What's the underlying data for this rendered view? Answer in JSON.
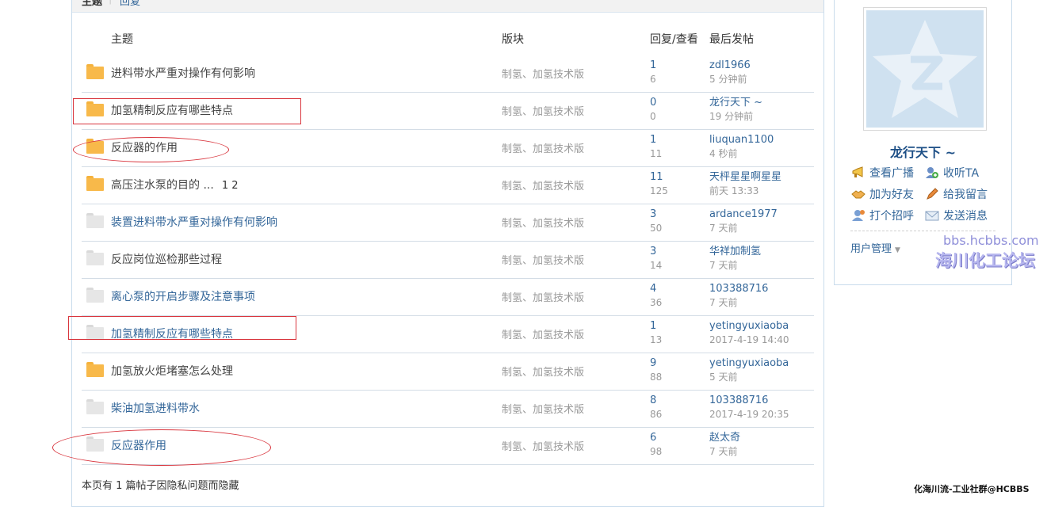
{
  "tabs": {
    "topic": "主题",
    "separator": "|",
    "reply": "回复"
  },
  "columns": {
    "topic": "主题",
    "forum": "版块",
    "stats": "回复/查看",
    "last_post": "最后发帖"
  },
  "threads": [
    {
      "icon": "folder-open",
      "title": "进料带水严重对操作有何影响",
      "forum": "制氢、加氢技术版",
      "replies": "1",
      "views": "6",
      "last_user": "zdl1966",
      "last_time": "5 分钟前"
    },
    {
      "icon": "folder-open",
      "title": "加氢精制反应有哪些特点",
      "forum": "制氢、加氢技术版",
      "replies": "0",
      "views": "0",
      "last_user": "龙行天下 ~",
      "last_time": "19 分钟前"
    },
    {
      "icon": "folder-open",
      "title": "反应器的作用",
      "forum": "制氢、加氢技术版",
      "replies": "1",
      "views": "11",
      "last_user": "liuquan1100",
      "last_time": "4 秒前"
    },
    {
      "icon": "folder-open",
      "title": "高压注水泵的目的 ...",
      "pages": "1   2",
      "forum": "制氢、加氢技术版",
      "replies": "11",
      "views": "125",
      "last_user": "天枰星星啊星星",
      "last_time": "前天 13:33"
    },
    {
      "icon": "folder-grey",
      "title": "装置进料带水严重对操作有何影响",
      "forum": "制氢、加氢技术版",
      "replies": "3",
      "views": "50",
      "last_user": "ardance1977",
      "last_time": "7 天前"
    },
    {
      "icon": "folder-grey",
      "title": "反应岗位巡检那些过程",
      "forum": "制氢、加氢技术版",
      "replies": "3",
      "views": "14",
      "last_user": "华祥加制氢",
      "last_time": "7 天前"
    },
    {
      "icon": "folder-grey",
      "title": "离心泵的开启步骤及注意事项",
      "forum": "制氢、加氢技术版",
      "replies": "4",
      "views": "36",
      "last_user": "103388716",
      "last_time": "7 天前"
    },
    {
      "icon": "folder-grey",
      "title": "加氢精制反应有哪些特点",
      "forum": "制氢、加氢技术版",
      "replies": "1",
      "views": "13",
      "last_user": "yetingyuxiaoba",
      "last_time": "2017-4-19 14:40"
    },
    {
      "icon": "folder-open",
      "title": "加氢放火炬堵塞怎么处理",
      "forum": "制氢、加氢技术版",
      "replies": "9",
      "views": "88",
      "last_user": "yetingyuxiaoba",
      "last_time": "5 天前"
    },
    {
      "icon": "folder-grey",
      "title": "柴油加氢进料带水",
      "forum": "制氢、加氢技术版",
      "replies": "8",
      "views": "86",
      "last_user": "103388716",
      "last_time": "2017-4-19 20:35"
    },
    {
      "icon": "folder-grey",
      "title": "反应器作用",
      "forum": "制氢、加氢技术版",
      "replies": "6",
      "views": "98",
      "last_user": "赵太奇",
      "last_time": "7 天前"
    }
  ],
  "footer_note": "本页有 1 篇帖子因隐私问题而隐藏",
  "profile": {
    "username": "龙行天下 ~",
    "actions": [
      "查看广播",
      "收听TA",
      "加为好友",
      "给我留言",
      "打个招呼",
      "发送消息"
    ],
    "user_management": "用户管理"
  },
  "watermarks": {
    "site": "bbs.hcbbs.com",
    "name": "海川化工论坛",
    "footer": "化海川流-工业社群@HCBBS"
  },
  "colors": {
    "link": "#336699",
    "muted": "#999999",
    "annotation": "#d9363e",
    "folder": "#f8b94a"
  }
}
